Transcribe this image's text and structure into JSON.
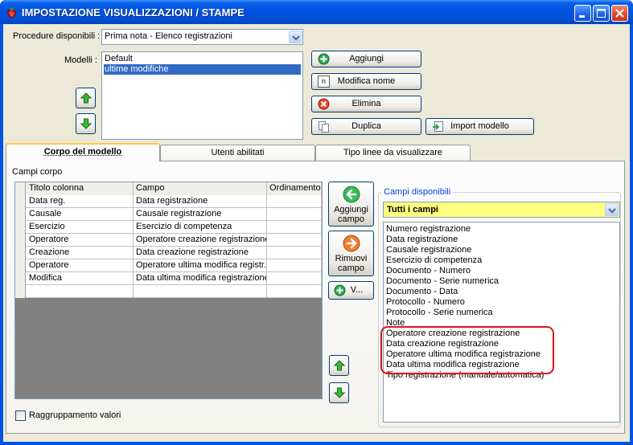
{
  "window": {
    "title": "IMPOSTAZIONE VISUALIZZAZIONI / STAMPE",
    "app_icon": "strawberry-icon"
  },
  "procedures": {
    "label": "Procedure disponibili :",
    "selected": "Prima nota - Elenco registrazioni"
  },
  "models": {
    "label": "Modelli :",
    "items": [
      "Default",
      "ultime modifiche"
    ],
    "selected_index": 1
  },
  "model_buttons": {
    "add": "Aggiungi",
    "rename": "Modifica nome",
    "delete": "Elimina",
    "duplicate": "Duplica",
    "import": "Import modello",
    "rename_icon_glyph": "n"
  },
  "tabs": [
    {
      "label": "Corpo del modello",
      "active": true
    },
    {
      "label": "Utenti abilitati",
      "active": false
    },
    {
      "label": "Tipo linee da visualizzare",
      "active": false
    }
  ],
  "body_fields": {
    "label": "Campi corpo",
    "columns": [
      "Titolo colonna",
      "Campo",
      "Ordinamento"
    ],
    "rows": [
      [
        "Data reg.",
        "Data registrazione",
        ""
      ],
      [
        "Causale",
        "Causale registrazione",
        ""
      ],
      [
        "Esercizio",
        "Esercizio di competenza",
        ""
      ],
      [
        "Operatore",
        "Operatore creazione registrazione",
        ""
      ],
      [
        "Creazione",
        "Data creazione registrazione",
        ""
      ],
      [
        "Operatore",
        "Operatore ultima modifica registr...",
        ""
      ],
      [
        "Modifica",
        "Data ultima modifica registrazione",
        ""
      ],
      [
        "",
        "",
        ""
      ]
    ]
  },
  "middle_buttons": {
    "add_field_1": "Aggiungi",
    "add_field_2": "campo",
    "remove_field_1": "Rimuovi",
    "remove_field_2": "campo",
    "v_button": "V..."
  },
  "available_fields": {
    "label": "Campi disponibili",
    "filter": "Tutti i campi",
    "items": [
      "Numero registrazione",
      "Data registrazione",
      "Causale registrazione",
      "Esercizio di competenza",
      "Documento - Numero",
      "Documento - Serie numerica",
      "Documento - Data",
      "Protocollo - Numero",
      "Protocollo - Serie numerica",
      "Note",
      "Operatore creazione registrazione",
      "Data creazione registrazione",
      "Operatore ultima modifica registrazione",
      "Data ultima modifica registrazione",
      "Tipo registrazione (manuale/automatica)"
    ]
  },
  "grouping": {
    "label": "Raggruppamento valori",
    "checked": false
  },
  "colors": {
    "title_blue": "#0054e3",
    "selection": "#316ac5",
    "filter_yellow": "#ffff80",
    "highlight_red": "#e0141e",
    "green_icon": "#2fa84f",
    "orange_icon": "#f08030"
  }
}
